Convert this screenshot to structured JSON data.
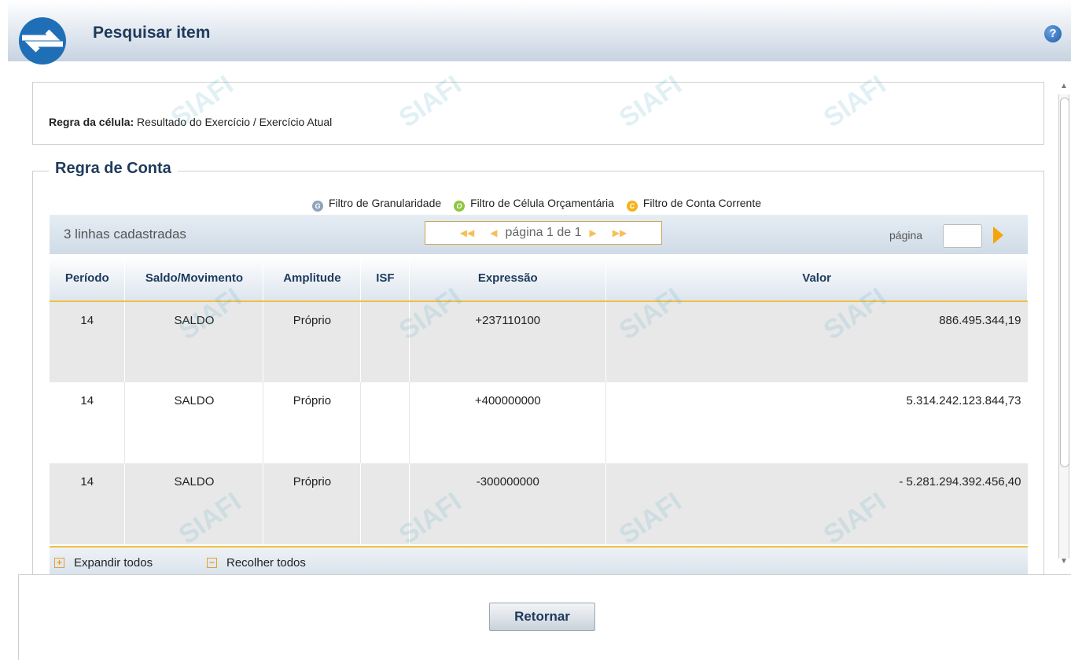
{
  "header": {
    "title": "Pesquisar item",
    "help_label": "?"
  },
  "rule": {
    "label": "Regra da célula:",
    "value": "Resultado do Exercício / Exercício Atual"
  },
  "section": {
    "title": "Regra de Conta"
  },
  "filters": [
    {
      "icon": "G",
      "label": "Filtro de Granularidade",
      "color": "#8da4bd"
    },
    {
      "icon": "O",
      "label": "Filtro de Célula Orçamentária",
      "color": "#8dc63f"
    },
    {
      "icon": "C",
      "label": "Filtro de Conta Corrente",
      "color": "#f5b21b"
    }
  ],
  "toolbar": {
    "count_text": "3 linhas cadastradas",
    "pager_text": "página 1 de 1",
    "page_label": "página",
    "page_input_value": ""
  },
  "table": {
    "columns": [
      "Período",
      "Saldo/Movimento",
      "Amplitude",
      "ISF",
      "Expressão",
      "Valor"
    ],
    "rows": [
      [
        "14",
        "SALDO",
        "Próprio",
        "",
        "+237110100",
        "886.495.344,19"
      ],
      [
        "14",
        "SALDO",
        "Próprio",
        "",
        "+400000000",
        "5.314.242.123.844,73"
      ],
      [
        "14",
        "SALDO",
        "Próprio",
        "",
        "-300000000",
        "- 5.281.294.392.456,40"
      ]
    ]
  },
  "footer_actions": {
    "expand_label": "Expandir todos",
    "collapse_label": "Recolher todos"
  },
  "bottom": {
    "return_label": "Retornar"
  },
  "watermark": "SIAFI"
}
